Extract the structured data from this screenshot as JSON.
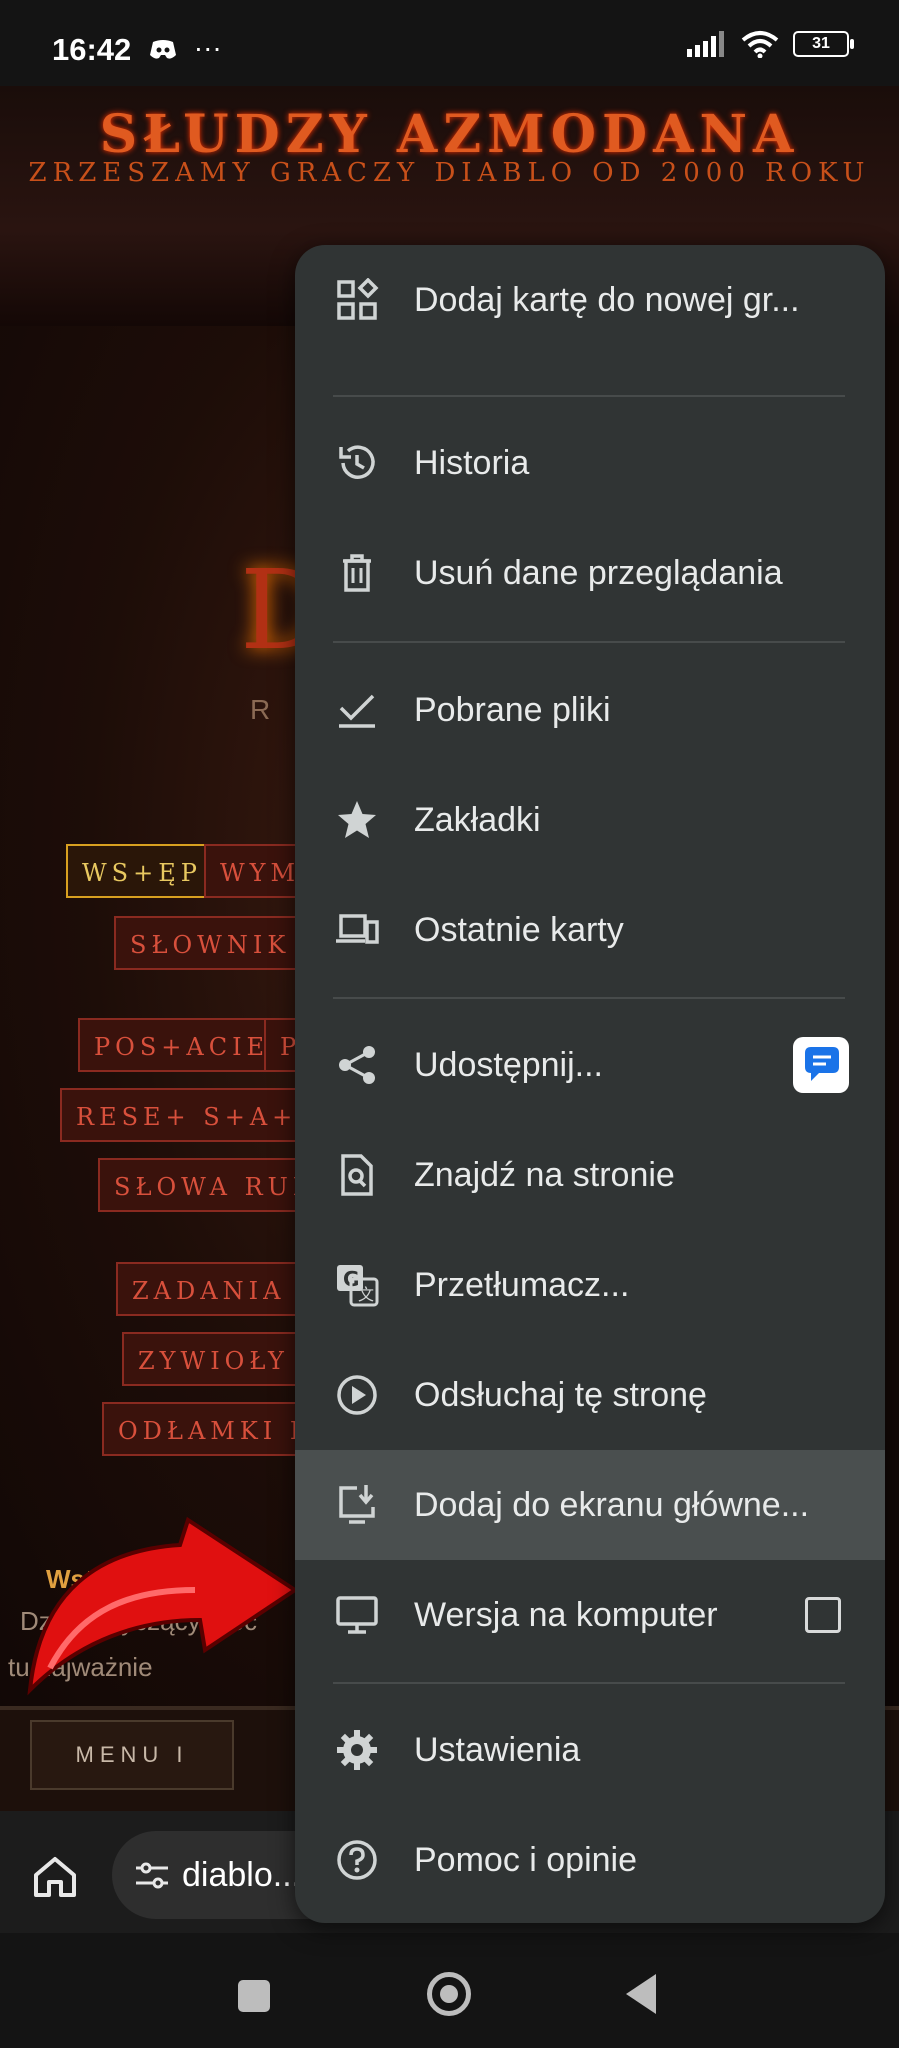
{
  "status_bar": {
    "time": "16:42",
    "more": "···",
    "battery": "31"
  },
  "website": {
    "title": "SŁUDZY AZMODANA",
    "subtitle": "ZRZESZAMY GRACZY DIABLO OD 2000 ROKU",
    "logo_letter": "D",
    "logo_sub": "R I",
    "buttons": [
      "WS+ĘP",
      "WYM",
      "SŁOWNIK B",
      "POS+ACIE",
      "PI",
      "RESE+ S+A+Y",
      "SŁOWA RUN",
      "ZADANIA",
      "ZYWIOŁY",
      "ODŁAMKI KA"
    ],
    "heading": "Wstęp",
    "text_line1": "Dział dotyczący mec",
    "text_line2": "tu najważnie",
    "menu_button": "MENU I"
  },
  "browser": {
    "url": "diablo..."
  },
  "menu": {
    "items": [
      {
        "label": "Dodaj kartę do nowej gr...",
        "icon": "add-tab-group-icon"
      },
      {
        "label": "Historia",
        "icon": "history-icon"
      },
      {
        "label": "Usuń dane przeglądania",
        "icon": "trash-icon"
      },
      {
        "label": "Pobrane pliki",
        "icon": "downloads-icon"
      },
      {
        "label": "Zakładki",
        "icon": "star-icon"
      },
      {
        "label": "Ostatnie karty",
        "icon": "devices-icon"
      },
      {
        "label": "Udostępnij...",
        "icon": "share-icon"
      },
      {
        "label": "Znajdź na stronie",
        "icon": "find-in-page-icon"
      },
      {
        "label": "Przetłumacz...",
        "icon": "translate-icon"
      },
      {
        "label": "Odsłuchaj tę stronę",
        "icon": "play-icon"
      },
      {
        "label": "Dodaj do ekranu główne...",
        "icon": "add-to-home-icon"
      },
      {
        "label": "Wersja na komputer",
        "icon": "desktop-icon"
      },
      {
        "label": "Ustawienia",
        "icon": "gear-icon"
      },
      {
        "label": "Pomoc i opinie",
        "icon": "help-icon"
      }
    ]
  }
}
